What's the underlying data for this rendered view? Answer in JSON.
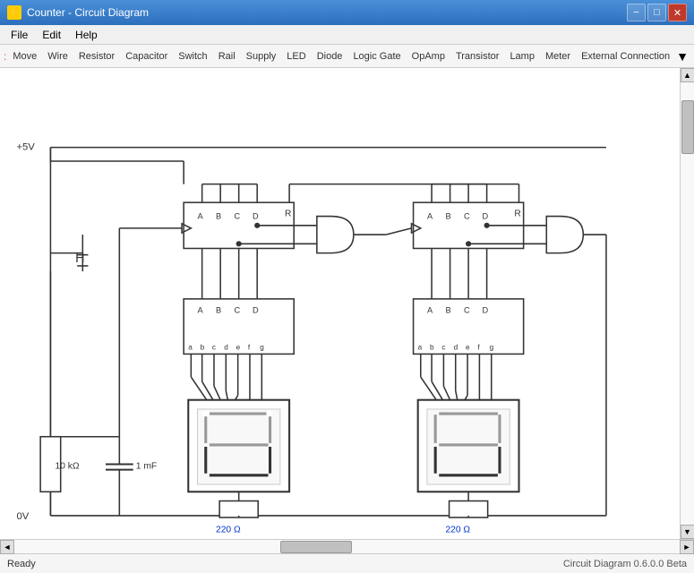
{
  "titleBar": {
    "icon": "⚡",
    "title": "Counter - Circuit Diagram",
    "minimizeLabel": "−",
    "maximizeLabel": "□",
    "closeLabel": "✕"
  },
  "menuBar": {
    "items": [
      "File",
      "Edit",
      "Help"
    ]
  },
  "toolbar": {
    "items": [
      "Move",
      "Wire",
      "Resistor",
      "Capacitor",
      "Switch",
      "Rail",
      "Supply",
      "LED",
      "Diode",
      "Logic Gate",
      "OpAmp",
      "Transistor",
      "Lamp",
      "Meter",
      "External Connection"
    ]
  },
  "statusBar": {
    "ready": "Ready",
    "version": "Circuit Diagram 0.6.0.0 Beta"
  },
  "scrollbar": {
    "upArrow": "▲",
    "downArrow": "▼",
    "leftArrow": "◄",
    "rightArrow": "►"
  }
}
